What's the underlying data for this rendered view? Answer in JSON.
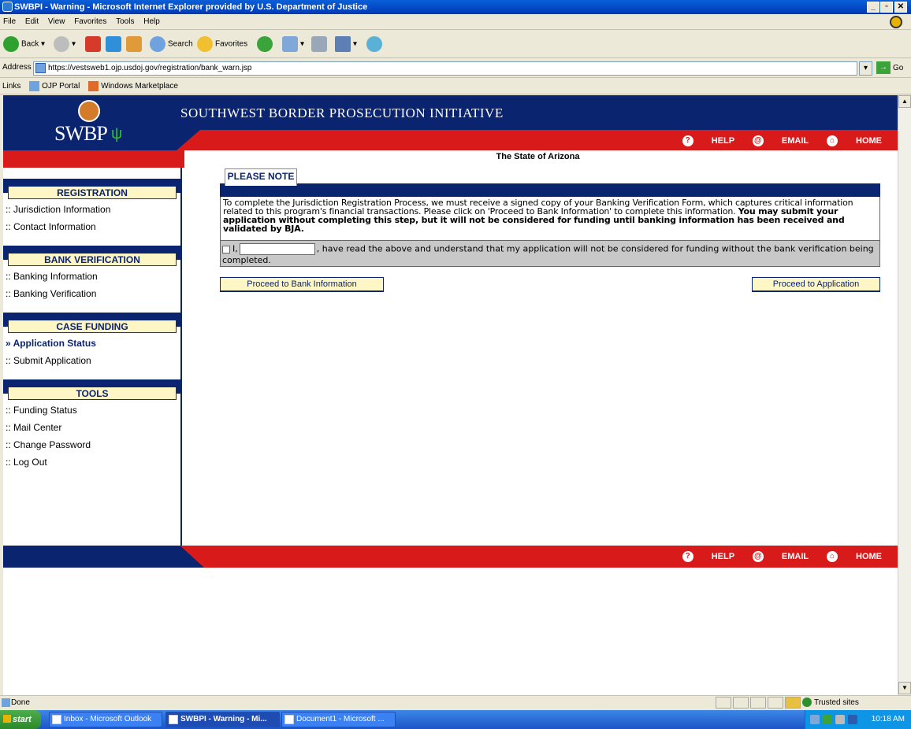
{
  "window": {
    "title": "SWBPI - Warning - Microsoft Internet Explorer provided by U.S. Department of Justice"
  },
  "menu": [
    "File",
    "Edit",
    "View",
    "Favorites",
    "Tools",
    "Help"
  ],
  "toolbar": {
    "back": "Back",
    "search": "Search",
    "favorites": "Favorites"
  },
  "address": {
    "label": "Address",
    "url": "https://vestsweb1.ojp.usdoj.gov/registration/bank_warn.jsp",
    "go": "Go"
  },
  "links": {
    "label": "Links",
    "items": [
      "OJP Portal",
      "Windows Marketplace"
    ]
  },
  "site": {
    "title": "SOUTHWEST BORDER PROSECUTION INITIATIVE",
    "logo_text": "SWBP",
    "nav": {
      "help": "HELP",
      "email": "EMAIL",
      "home": "HOME"
    },
    "state": "The State of Arizona"
  },
  "sidebar": {
    "registration": {
      "title": "REGISTRATION",
      "items": [
        ":: Jurisdiction Information",
        ":: Contact Information"
      ]
    },
    "bank": {
      "title": "BANK VERIFICATION",
      "items": [
        ":: Banking Information",
        ":: Banking Verification"
      ]
    },
    "case": {
      "title": "CASE FUNDING",
      "items": [
        "» Application Status",
        ":: Submit Application"
      ]
    },
    "tools": {
      "title": "TOOLS",
      "items": [
        ":: Funding Status",
        ":: Mail Center",
        ":: Change Password",
        ":: Log Out"
      ]
    }
  },
  "note": {
    "tab": "PLEASE NOTE",
    "text": "To complete the Jurisdiction Registration Process, we must receive a signed copy of your Banking Verification Form, which captures critical information related to this program's financial transactions.  Please click on 'Proceed to Bank Information' to complete this information.",
    "bold": "You may submit your application without completing this step, but it will not be considered for funding until banking information has been received and validated by BJA.",
    "ack_prefix": "I,",
    "ack_suffix": ", have read the above and understand that my application will not be considered for funding without the bank verification being completed.",
    "name_value": ""
  },
  "buttons": {
    "proceed_bank": "Proceed to Bank Information",
    "proceed_app": "Proceed to Application"
  },
  "status": {
    "text": "Done",
    "zone": "Trusted sites"
  },
  "taskbar": {
    "start": "start",
    "tasks": [
      "Inbox - Microsoft Outlook",
      "SWBPI - Warning - Mi...",
      "Document1 - Microsoft ..."
    ],
    "time": "10:18 AM"
  }
}
